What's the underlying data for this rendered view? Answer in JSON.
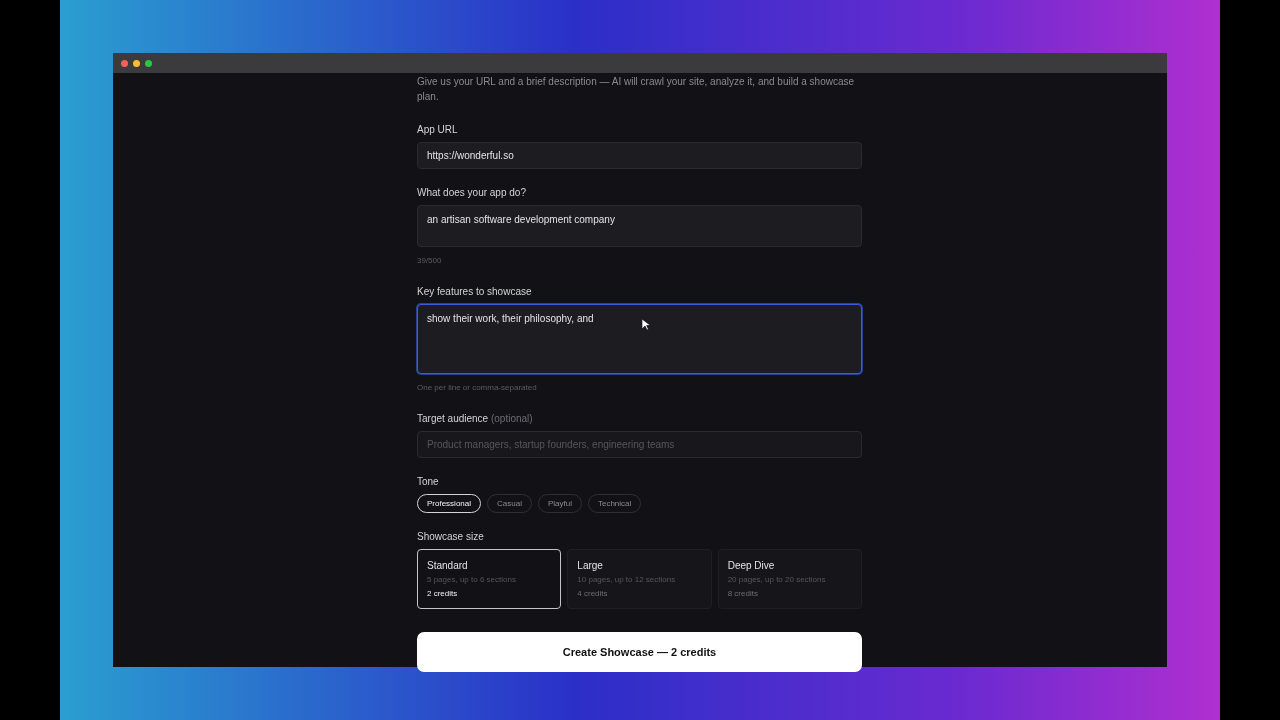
{
  "intro": "Give us your URL and a brief description — AI will crawl your site, analyze it, and build a showcase plan.",
  "app_url": {
    "label": "App URL",
    "value": "https://wonderful.so"
  },
  "description": {
    "label": "What does your app do?",
    "value": "an artisan software development company",
    "counter": "39/500"
  },
  "features": {
    "label": "Key features to showcase",
    "value": "show their work, their philosophy, and",
    "focused": true,
    "hint": "One per line or comma-separated"
  },
  "audience": {
    "label": "Target audience",
    "optional": "(optional)",
    "placeholder": "Product managers, startup founders, engineering teams"
  },
  "tone": {
    "label": "Tone",
    "options": [
      {
        "label": "Professional",
        "selected": true
      },
      {
        "label": "Casual",
        "selected": false
      },
      {
        "label": "Playful",
        "selected": false
      },
      {
        "label": "Technical",
        "selected": false
      }
    ]
  },
  "size": {
    "label": "Showcase size",
    "options": [
      {
        "title": "Standard",
        "detail": "5 pages, up to 6 sections",
        "credits": "2 credits",
        "selected": true
      },
      {
        "title": "Large",
        "detail": "10 pages, up to 12 sections",
        "credits": "4 credits",
        "selected": false
      },
      {
        "title": "Deep Dive",
        "detail": "20 pages, up to 20 sections",
        "credits": "8 credits",
        "selected": false
      }
    ]
  },
  "submit": "Create Showcase — 2 credits"
}
